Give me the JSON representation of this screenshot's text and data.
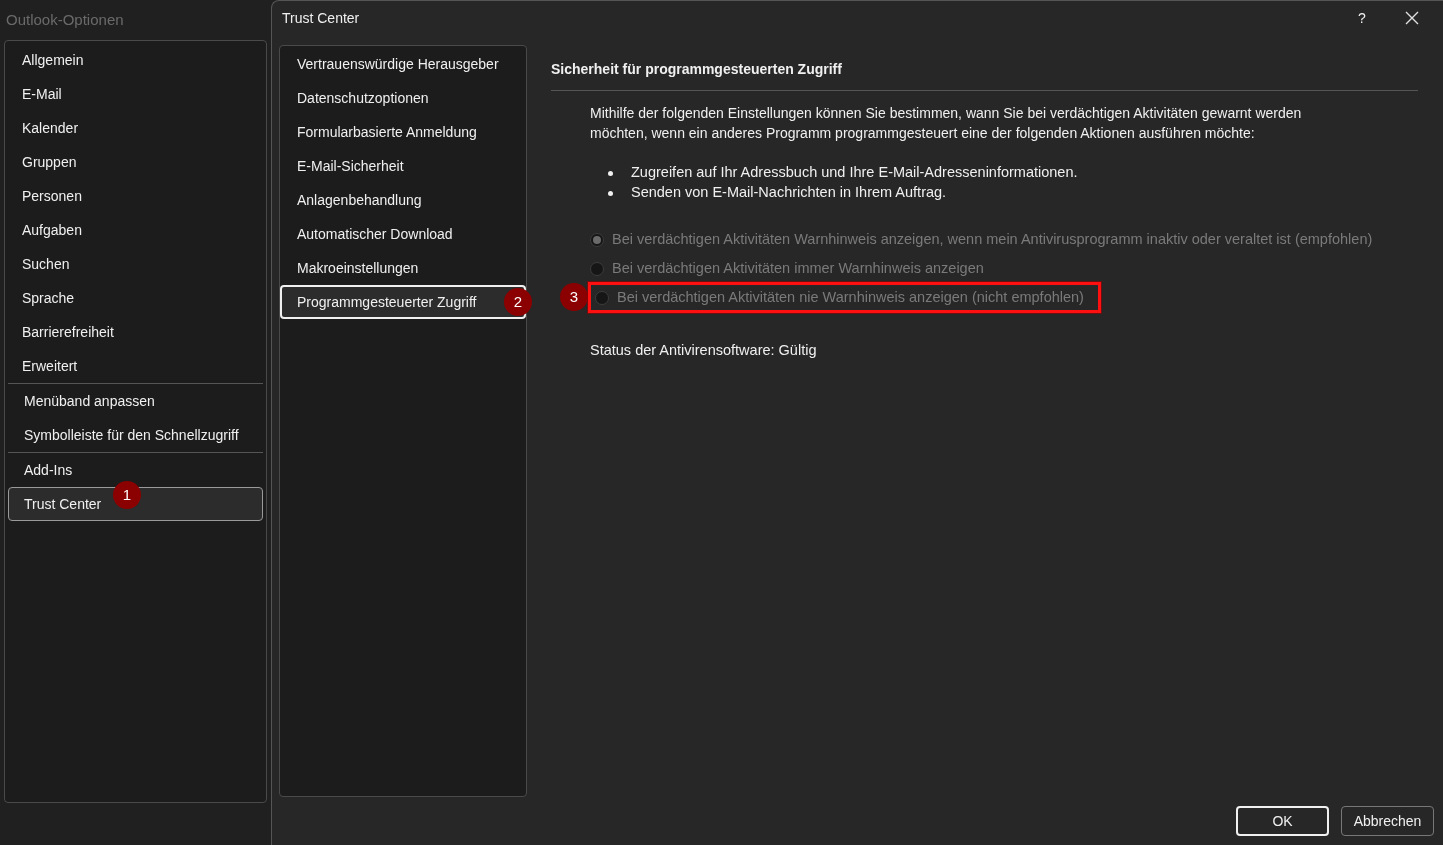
{
  "outer_window": {
    "title": "Outlook-Optionen"
  },
  "sidebar": {
    "groups": [
      [
        {
          "label": "Allgemein",
          "selected": false
        },
        {
          "label": "E-Mail",
          "selected": false
        },
        {
          "label": "Kalender",
          "selected": false
        },
        {
          "label": "Gruppen",
          "selected": false
        },
        {
          "label": "Personen",
          "selected": false
        },
        {
          "label": "Aufgaben",
          "selected": false
        },
        {
          "label": "Suchen",
          "selected": false
        },
        {
          "label": "Sprache",
          "selected": false
        },
        {
          "label": "Barrierefreiheit",
          "selected": false
        },
        {
          "label": "Erweitert",
          "selected": false
        }
      ],
      [
        {
          "label": "Menüband anpassen",
          "selected": false
        },
        {
          "label": "Symbolleiste für den Schnellzugriff",
          "selected": false
        }
      ],
      [
        {
          "label": "Add-Ins",
          "selected": false
        },
        {
          "label": "Trust Center",
          "selected": true,
          "marker": "1"
        }
      ]
    ]
  },
  "dialog": {
    "title": "Trust Center",
    "help": "?"
  },
  "nav": [
    {
      "label": "Vertrauenswürdige Herausgeber",
      "selected": false
    },
    {
      "label": "Datenschutzoptionen",
      "selected": false
    },
    {
      "label": "Formularbasierte Anmeldung",
      "selected": false
    },
    {
      "label": "E-Mail-Sicherheit",
      "selected": false
    },
    {
      "label": "Anlagenbehandlung",
      "selected": false
    },
    {
      "label": "Automatischer Download",
      "selected": false
    },
    {
      "label": "Makroeinstellungen",
      "selected": false
    },
    {
      "label": "Programmgesteuerter Zugriff",
      "selected": true,
      "marker": "2"
    }
  ],
  "content": {
    "heading": "Sicherheit für programmgesteuerten Zugriff",
    "intro": "Mithilfe der folgenden Einstellungen können Sie bestimmen, wann Sie bei verdächtigen Aktivitäten gewarnt werden möchten, wenn ein anderes Programm programmgesteuert eine der folgenden Aktionen ausführen möchte:",
    "bullets": [
      "Zugreifen auf Ihr Adressbuch und Ihre E-Mail-Adresseninformationen.",
      "Senden von E-Mail-Nachrichten in Ihrem Auftrag."
    ],
    "options": [
      {
        "label": "Bei verdächtigen Aktivitäten Warnhinweis anzeigen, wenn mein Antivirusprogramm inaktiv oder veraltet ist (empfohlen)",
        "selected": true,
        "disabled": true,
        "highlighted": false
      },
      {
        "label": "Bei verdächtigen Aktivitäten immer Warnhinweis anzeigen",
        "selected": false,
        "disabled": true,
        "highlighted": false
      },
      {
        "label": "Bei verdächtigen Aktivitäten nie Warnhinweis anzeigen (nicht empfohlen)",
        "selected": false,
        "disabled": true,
        "highlighted": true,
        "marker": "3"
      }
    ],
    "status": "Status der Antivirensoftware: Gültig"
  },
  "buttons": [
    {
      "label": "OK",
      "default": true
    },
    {
      "label": "Abbrechen",
      "default": false
    }
  ]
}
